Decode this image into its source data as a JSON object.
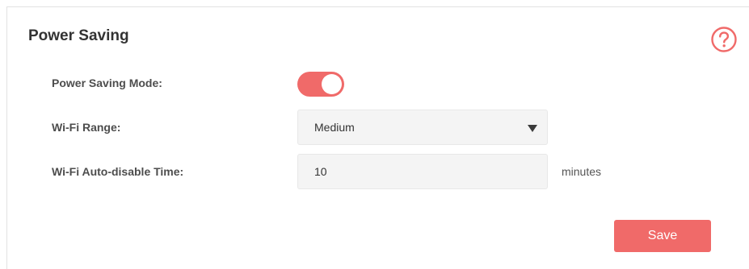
{
  "section": {
    "title": "Power Saving"
  },
  "icons": {
    "help": "question-circle-icon",
    "dropdown": "caret-down-icon"
  },
  "power_saving_mode": {
    "label": "Power Saving Mode:",
    "enabled": true
  },
  "wifi_range": {
    "label": "Wi-Fi Range:",
    "selected": "Medium"
  },
  "auto_disable": {
    "label": "Wi-Fi Auto-disable Time:",
    "value": "10",
    "unit": "minutes"
  },
  "actions": {
    "save_label": "Save"
  },
  "colors": {
    "accent": "#f06a69",
    "field_bg": "#f4f4f4",
    "label_text": "#4d4d4d"
  }
}
